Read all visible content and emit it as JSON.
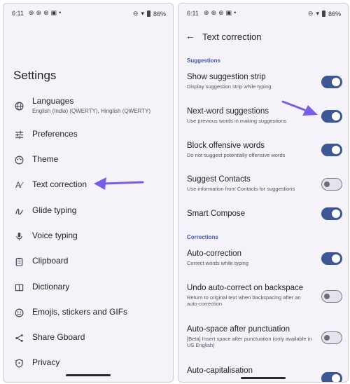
{
  "left": {
    "status": {
      "time": "6:11",
      "battery": "86%"
    },
    "title": "Settings",
    "items": [
      {
        "label": "Languages",
        "sublabel": "English (India) (QWERTY), Hinglish (QWERTY)",
        "icon": "globe-icon"
      },
      {
        "label": "Preferences",
        "icon": "sliders-icon"
      },
      {
        "label": "Theme",
        "icon": "palette-icon"
      },
      {
        "label": "Text correction",
        "icon": "text-correction-icon"
      },
      {
        "label": "Glide typing",
        "icon": "glide-icon"
      },
      {
        "label": "Voice typing",
        "icon": "mic-icon"
      },
      {
        "label": "Clipboard",
        "icon": "clipboard-icon"
      },
      {
        "label": "Dictionary",
        "icon": "book-icon"
      },
      {
        "label": "Emojis, stickers and GIFs",
        "icon": "emoji-icon"
      },
      {
        "label": "Share Gboard",
        "icon": "share-icon"
      },
      {
        "label": "Privacy",
        "icon": "shield-icon"
      }
    ]
  },
  "right": {
    "status": {
      "time": "6:11",
      "battery": "86%"
    },
    "title": "Text correction",
    "sections": {
      "suggestions": "Suggestions",
      "corrections": "Corrections"
    },
    "settings": [
      {
        "label": "Show suggestion strip",
        "sublabel": "Display suggestion strip while typing",
        "on": true
      },
      {
        "label": "Next-word suggestions",
        "sublabel": "Use previous words in making suggestions",
        "on": true
      },
      {
        "label": "Block offensive words",
        "sublabel": "Do not suggest potentially offensive words",
        "on": true
      },
      {
        "label": "Suggest Contacts",
        "sublabel": "Use information from Contacts for suggestions",
        "on": false
      },
      {
        "label": "Smart Compose",
        "sublabel": "",
        "on": true
      },
      {
        "label": "Auto-correction",
        "sublabel": "Correct words while typing",
        "on": true
      },
      {
        "label": "Undo auto-correct on backspace",
        "sublabel": "Return to original text when backspacing after an auto-correction",
        "on": false
      },
      {
        "label": "Auto-space after punctuation",
        "sublabel": "[Beta] Insert space after punctuation (only available in US English)",
        "on": false
      },
      {
        "label": "Auto-capitalisation",
        "sublabel": "",
        "on": true
      }
    ]
  },
  "colors": {
    "accent": "#3c5793",
    "arrow": "#7b5ce6",
    "background": "#f5f2fa"
  }
}
